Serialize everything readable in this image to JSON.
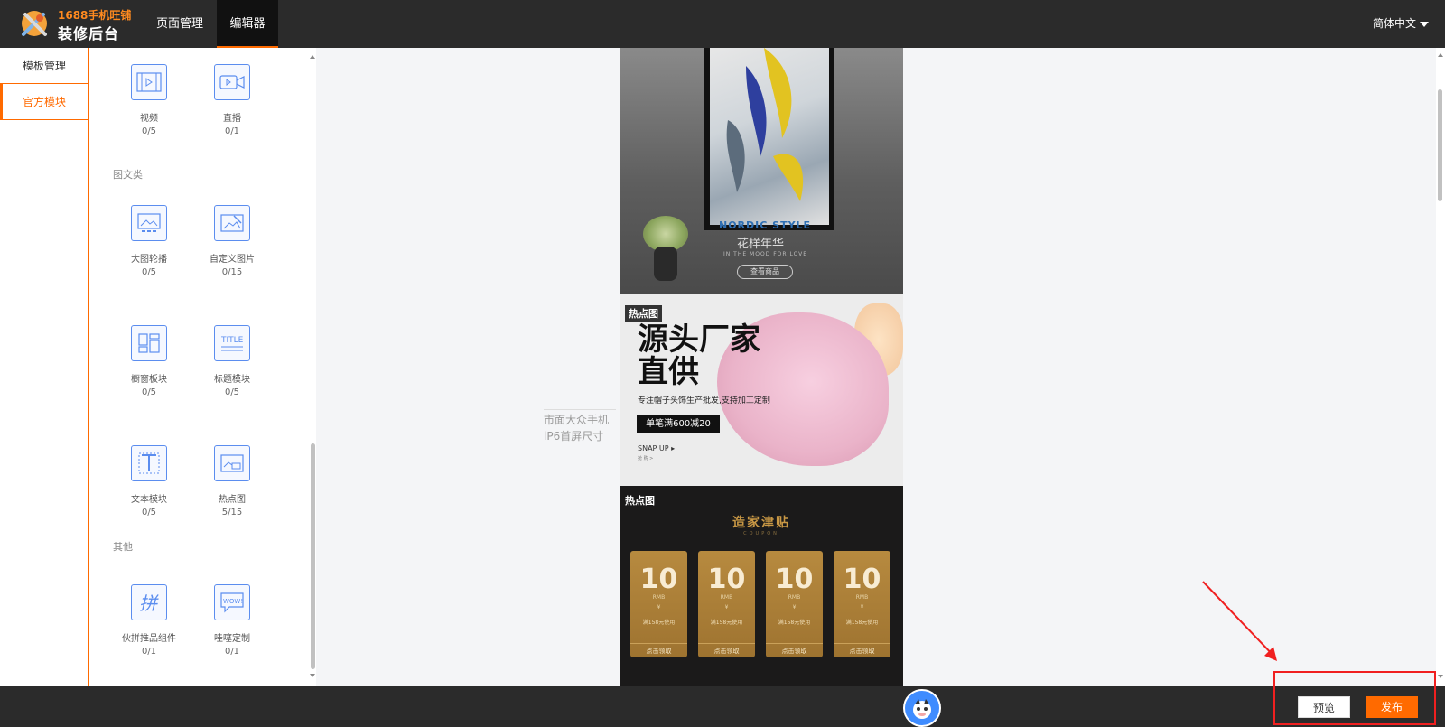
{
  "header": {
    "logo_line1": "1688手机旺铺",
    "logo_line2": "装修后台",
    "nav": [
      {
        "label": "页面管理"
      },
      {
        "label": "编辑器"
      }
    ],
    "language": "简体中文"
  },
  "leftnav": {
    "items": [
      {
        "label": "模板管理"
      },
      {
        "label": "官方模块"
      }
    ]
  },
  "modules": {
    "media": [
      {
        "name": "视频",
        "count": "0/5"
      },
      {
        "name": "直播",
        "count": "0/1"
      }
    ],
    "group_image_text": "图文类",
    "image_text": [
      {
        "name": "大图轮播",
        "count": "0/5"
      },
      {
        "name": "自定义图片",
        "count": "0/15"
      },
      {
        "name": "橱窗板块",
        "count": "0/5"
      },
      {
        "name": "标题模块",
        "count": "0/5"
      },
      {
        "name": "文本模块",
        "count": "0/5"
      },
      {
        "name": "热点图",
        "count": "5/15"
      }
    ],
    "group_other": "其他",
    "other": [
      {
        "name": "伙拼推品组件",
        "count": "0/1"
      },
      {
        "name": "哇噻定制",
        "count": "0/1"
      }
    ]
  },
  "canvas": {
    "label_line1": "市面大众手机",
    "label_line2": "iP6首屏尺寸"
  },
  "phone": {
    "banner1": {
      "nordic": "NORDIC STYLE",
      "title": "花样年华",
      "mood": "IN THE MOOD FOR LOVE",
      "button": "查看商品"
    },
    "banner2": {
      "tag": "热点图",
      "headline_line1": "源头厂家",
      "headline_line2": "直供",
      "subline": "专注帽子头饰生产批发,支持加工定制",
      "promo": "单笔满600减20",
      "snap": "SNAP UP",
      "tiny": "抢 购 >"
    },
    "banner3": {
      "tag": "热点图",
      "title": "造家津贴",
      "subtitle": "COUPON",
      "coupons": [
        {
          "value": "10",
          "unit": "RMB",
          "dot": "¥",
          "desc": "满158元使用",
          "button": "点击领取"
        },
        {
          "value": "10",
          "unit": "RMB",
          "dot": "¥",
          "desc": "满158元使用",
          "button": "点击领取"
        },
        {
          "value": "10",
          "unit": "RMB",
          "dot": "¥",
          "desc": "满158元使用",
          "button": "点击领取"
        },
        {
          "value": "10",
          "unit": "RMB",
          "dot": "¥",
          "desc": "满158元使用",
          "button": "点击领取"
        }
      ]
    }
  },
  "footer": {
    "preview": "预览",
    "publish": "发布"
  },
  "colors": {
    "accent": "#ff6a00",
    "topbar": "#2b2b2b",
    "icon_border": "#5b8def",
    "annotation": "#f02020"
  }
}
